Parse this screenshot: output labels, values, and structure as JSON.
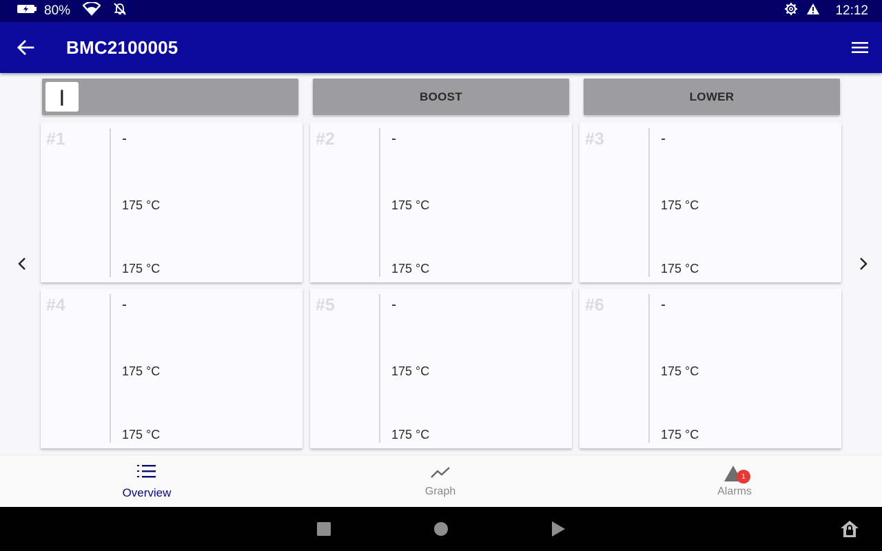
{
  "status_bar": {
    "battery": "80%",
    "time": "12:12"
  },
  "app_bar": {
    "title": "BMC2100005"
  },
  "controls": {
    "toggle_symbol": "|",
    "boost_label": "BOOST",
    "lower_label": "LOWER"
  },
  "cards": [
    {
      "number": "#1",
      "status": "-",
      "temp_1": "175 °C",
      "temp_2": "175 °C"
    },
    {
      "number": "#2",
      "status": "-",
      "temp_1": "175 °C",
      "temp_2": "175 °C"
    },
    {
      "number": "#3",
      "status": "-",
      "temp_1": "175 °C",
      "temp_2": "175 °C"
    },
    {
      "number": "#4",
      "status": "-",
      "temp_1": "175 °C",
      "temp_2": "175 °C"
    },
    {
      "number": "#5",
      "status": "-",
      "temp_1": "175 °C",
      "temp_2": "175 °C"
    },
    {
      "number": "#6",
      "status": "-",
      "temp_1": "175 °C",
      "temp_2": "175 °C"
    }
  ],
  "bottom_nav": {
    "items": [
      {
        "label": "Overview",
        "icon": "list-numbered-icon",
        "active": true
      },
      {
        "label": "Graph",
        "icon": "trend-line-icon",
        "active": false
      },
      {
        "label": "Alarms",
        "icon": "warning-triangle-icon",
        "active": false,
        "badge": "1"
      }
    ]
  },
  "icons": {
    "status_left": [
      "battery-charging-icon",
      "wifi-icon",
      "bell-off-icon"
    ],
    "status_right": [
      "settings-gear-icon",
      "warning-icon"
    ],
    "app_bar": [
      "back-arrow-icon",
      "hamburger-menu-icon"
    ],
    "pager": [
      "chevron-left-icon",
      "chevron-right-icon"
    ],
    "system": [
      "recents-square-icon",
      "home-circle-icon",
      "back-triangle-icon",
      "home-lock-icon"
    ]
  },
  "colors": {
    "status_bar": "#020066",
    "app_bar": "#0b0a9c",
    "active_nav": "#0b0a7a",
    "button_grey": "#9d9d9f",
    "badge": "#e53935"
  }
}
